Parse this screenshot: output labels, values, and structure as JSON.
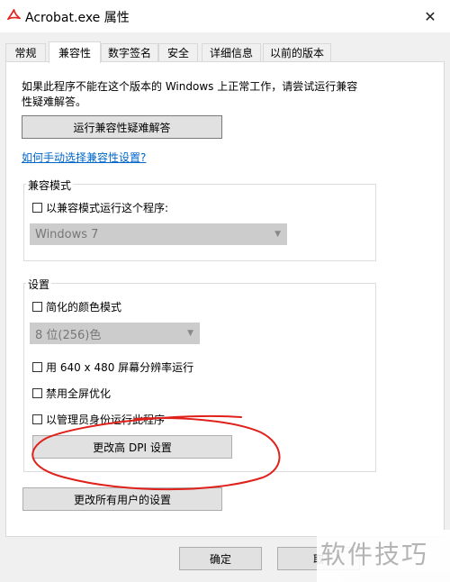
{
  "window": {
    "title": "Acrobat.exe 属性",
    "close_glyph": "✕"
  },
  "tabs": [
    {
      "label": "常规",
      "active": false
    },
    {
      "label": "兼容性",
      "active": true
    },
    {
      "label": "数字签名",
      "active": false
    },
    {
      "label": "安全",
      "active": false
    },
    {
      "label": "详细信息",
      "active": false
    },
    {
      "label": "以前的版本",
      "active": false
    }
  ],
  "intro": {
    "line1": "如果此程序不能在这个版本的 Windows 上正常工作，请尝试运行兼容",
    "line2": "性疑难解答。"
  },
  "troubleshooter_button": "运行兼容性疑难解答",
  "manual_link": "如何手动选择兼容性设置?",
  "compat_mode": {
    "group_label": "兼容模式",
    "checkbox_label": "以兼容模式运行这个程序:",
    "checked": false,
    "select_value": "Windows 7"
  },
  "settings": {
    "group_label": "设置",
    "reduced_color": {
      "label": "简化的颜色模式",
      "checked": false
    },
    "color_select_value": "8 位(256)色",
    "res_640": {
      "label": "用 640 x 480 屏幕分辨率运行",
      "checked": false
    },
    "disable_fullscreen": {
      "label": "禁用全屏优化",
      "checked": false
    },
    "run_as_admin": {
      "label": "以管理员身份运行此程序",
      "checked": false
    },
    "dpi_button": "更改高 DPI 设置"
  },
  "all_users_button": "更改所有用户的设置",
  "footer": {
    "ok_button": "确定",
    "cancel_button": "取"
  },
  "watermark": "软件技巧",
  "colors": {
    "annotation_red": "#e0201a",
    "link_blue": "#0066cc",
    "acrobat_red": "#e4211b"
  },
  "icons": {
    "app": "acrobat-icon",
    "close": "close-icon"
  }
}
